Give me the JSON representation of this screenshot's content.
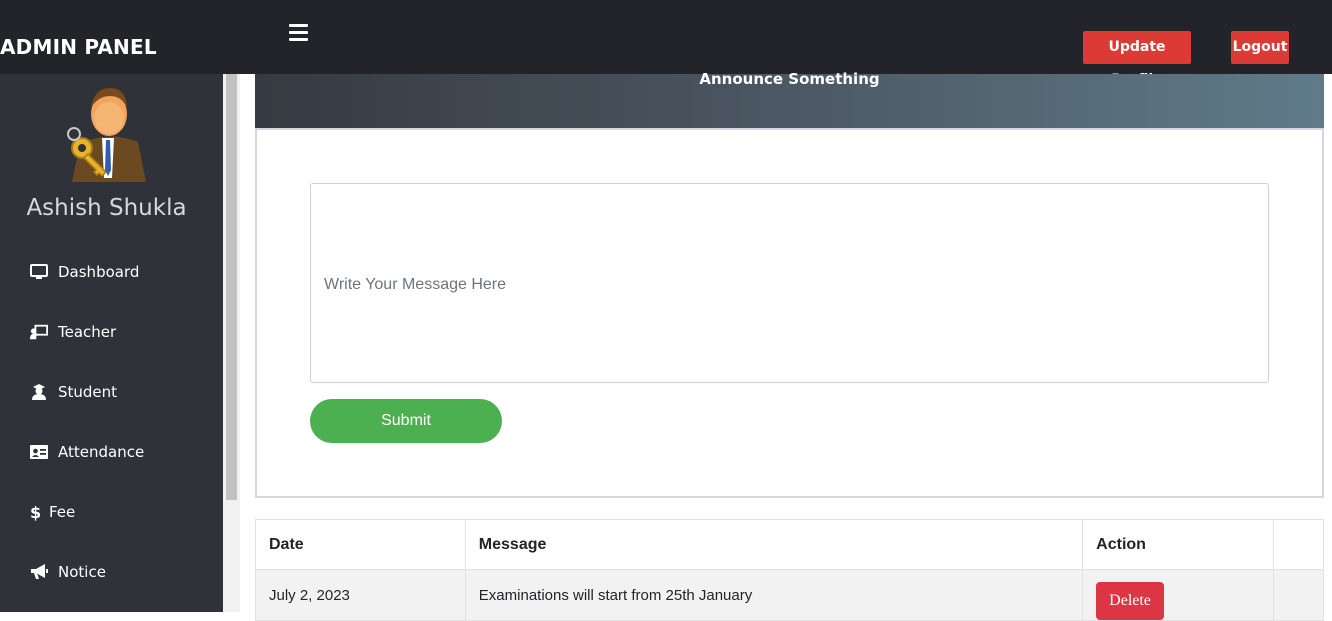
{
  "header": {
    "brand": "ADMIN PANEL",
    "menu_icon": "hamburger-menu-icon",
    "update_profile_label": "Update Profile",
    "logout_label": "Logout"
  },
  "sidebar": {
    "avatar_icon": "admin-user-with-key-icon",
    "user_name": "Ashish Shukla",
    "items": [
      {
        "label": "Dashboard",
        "icon": "monitor-icon"
      },
      {
        "label": "Teacher",
        "icon": "chalkboard-teacher-icon"
      },
      {
        "label": "Student",
        "icon": "graduate-user-icon"
      },
      {
        "label": "Attendance",
        "icon": "id-card-icon"
      },
      {
        "label": "Fee",
        "icon": "dollar-icon"
      },
      {
        "label": "Notice",
        "icon": "megaphone-icon"
      }
    ]
  },
  "announce": {
    "title": "Announce Something",
    "message_placeholder": "Write Your Message Here",
    "submit_label": "Submit"
  },
  "notices_table": {
    "headers": [
      "Date",
      "Message",
      "Action"
    ],
    "rows": [
      {
        "date": "July 2, 2023",
        "message": "Examinations will start from 25th January",
        "action_label": "Delete"
      }
    ]
  },
  "colors": {
    "topbar": "#222429",
    "sidebar": "#2f3238",
    "danger": "#dc3a34",
    "submit": "#4caf50"
  }
}
